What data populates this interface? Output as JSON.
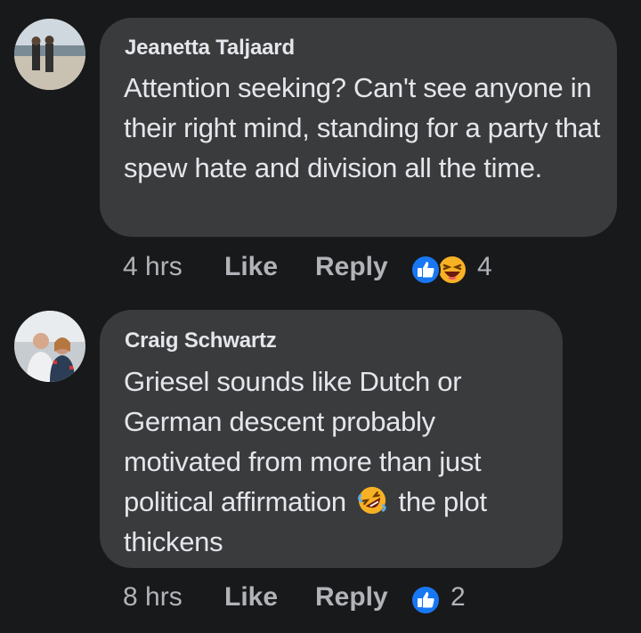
{
  "comments": [
    {
      "author": "Jeanetta Taljaard",
      "text": "Attention seeking? Can't see anyone in their right mind, standing for a party that spew hate and division all the time.",
      "time": "4 hrs",
      "like_label": "Like",
      "reply_label": "Reply",
      "reactions": [
        "like-icon",
        "haha-icon"
      ],
      "reaction_count": "4"
    },
    {
      "author": "Craig Schwartz",
      "text_before_emoji": "Griesel sounds like Dutch or German descent probably motivated from more than just political affirmation",
      "inline_emoji": "rolling-on-floor-laughing-icon",
      "text_after_emoji": "the plot thickens",
      "time": "8 hrs",
      "like_label": "Like",
      "reply_label": "Reply",
      "reactions": [
        "like-icon"
      ],
      "reaction_count": "2"
    }
  ],
  "colors": {
    "background": "#18191a",
    "bubble": "#3a3b3c",
    "primary_text": "#e4e6eb",
    "secondary_text": "#b0b3b8",
    "like_blue": "#1877f2",
    "haha_yellow": "#f7b125"
  }
}
